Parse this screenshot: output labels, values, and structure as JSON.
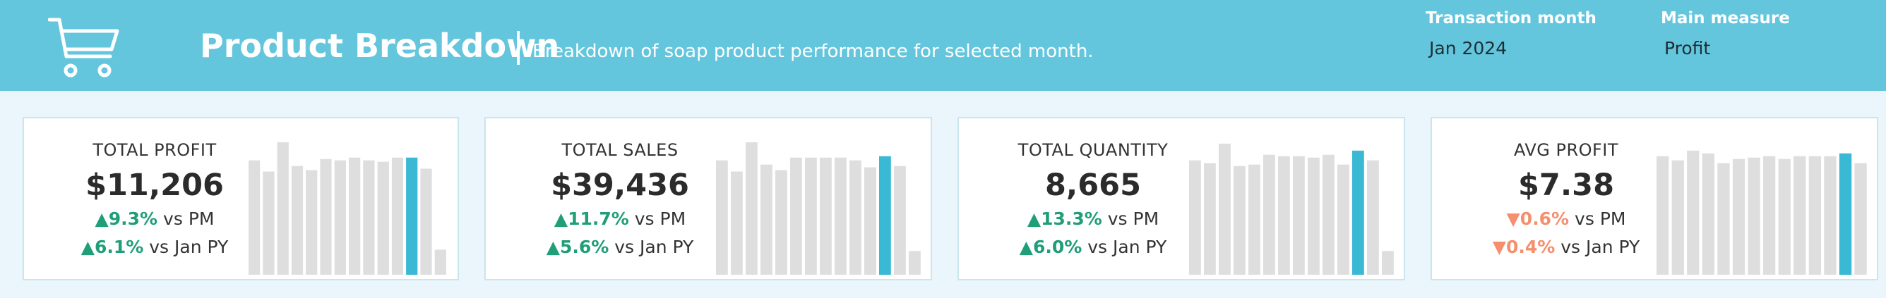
{
  "header": {
    "title": "Product Breakdown",
    "subtitle": "Breakdown of soap product performance for selected month.",
    "background_color": "#63c6dd",
    "icon": "shopping-cart-icon"
  },
  "filters": [
    {
      "label": "Transaction month",
      "value": "Jan 2024"
    },
    {
      "label": "Main measure",
      "value": "Profit"
    }
  ],
  "colors": {
    "bar_default": "#dedede",
    "bar_highlight": "#3ab9d4",
    "positive": "#1f9e78",
    "negative": "#f58f6e"
  },
  "cards": [
    {
      "label": "TOTAL PROFIT",
      "value": "$11,206",
      "vs_pm": {
        "arrow": "▲",
        "pct": "9.3%",
        "text": " vs PM",
        "direction": "up"
      },
      "vs_py": {
        "arrow": "▲",
        "pct": "6.1%",
        "text": " vs Jan PY",
        "direction": "up"
      },
      "bars": [
        0.82,
        0.74,
        0.95,
        0.78,
        0.75,
        0.83,
        0.82,
        0.84,
        0.82,
        0.81,
        0.84,
        0.84,
        0.76,
        0.18
      ],
      "highlight_index": 11
    },
    {
      "label": "TOTAL SALES",
      "value": "$39,436",
      "vs_pm": {
        "arrow": "▲",
        "pct": "11.7%",
        "text": " vs PM",
        "direction": "up"
      },
      "vs_py": {
        "arrow": "▲",
        "pct": "5.6%",
        "text": " vs Jan PY",
        "direction": "up"
      },
      "bars": [
        0.82,
        0.74,
        0.95,
        0.79,
        0.75,
        0.84,
        0.84,
        0.84,
        0.84,
        0.82,
        0.77,
        0.85,
        0.78,
        0.17
      ],
      "highlight_index": 11
    },
    {
      "label": "TOTAL QUANTITY",
      "value": "8,665",
      "vs_pm": {
        "arrow": "▲",
        "pct": "13.3%",
        "text": " vs PM",
        "direction": "up"
      },
      "vs_py": {
        "arrow": "▲",
        "pct": "6.0%",
        "text": " vs Jan PY",
        "direction": "up"
      },
      "bars": [
        0.82,
        0.8,
        0.94,
        0.78,
        0.79,
        0.86,
        0.85,
        0.85,
        0.84,
        0.86,
        0.79,
        0.89,
        0.82,
        0.17
      ],
      "highlight_index": 11
    },
    {
      "label": "AVG PROFIT",
      "value": "$7.38",
      "vs_pm": {
        "arrow": "▼",
        "pct": "0.6%",
        "text": " vs PM",
        "direction": "down"
      },
      "vs_py": {
        "arrow": "▼",
        "pct": "0.4%",
        "text": " vs Jan PY",
        "direction": "down"
      },
      "bars": [
        0.85,
        0.82,
        0.89,
        0.87,
        0.8,
        0.83,
        0.84,
        0.85,
        0.83,
        0.85,
        0.85,
        0.85,
        0.87,
        0.8
      ],
      "highlight_index": 12
    }
  ]
}
